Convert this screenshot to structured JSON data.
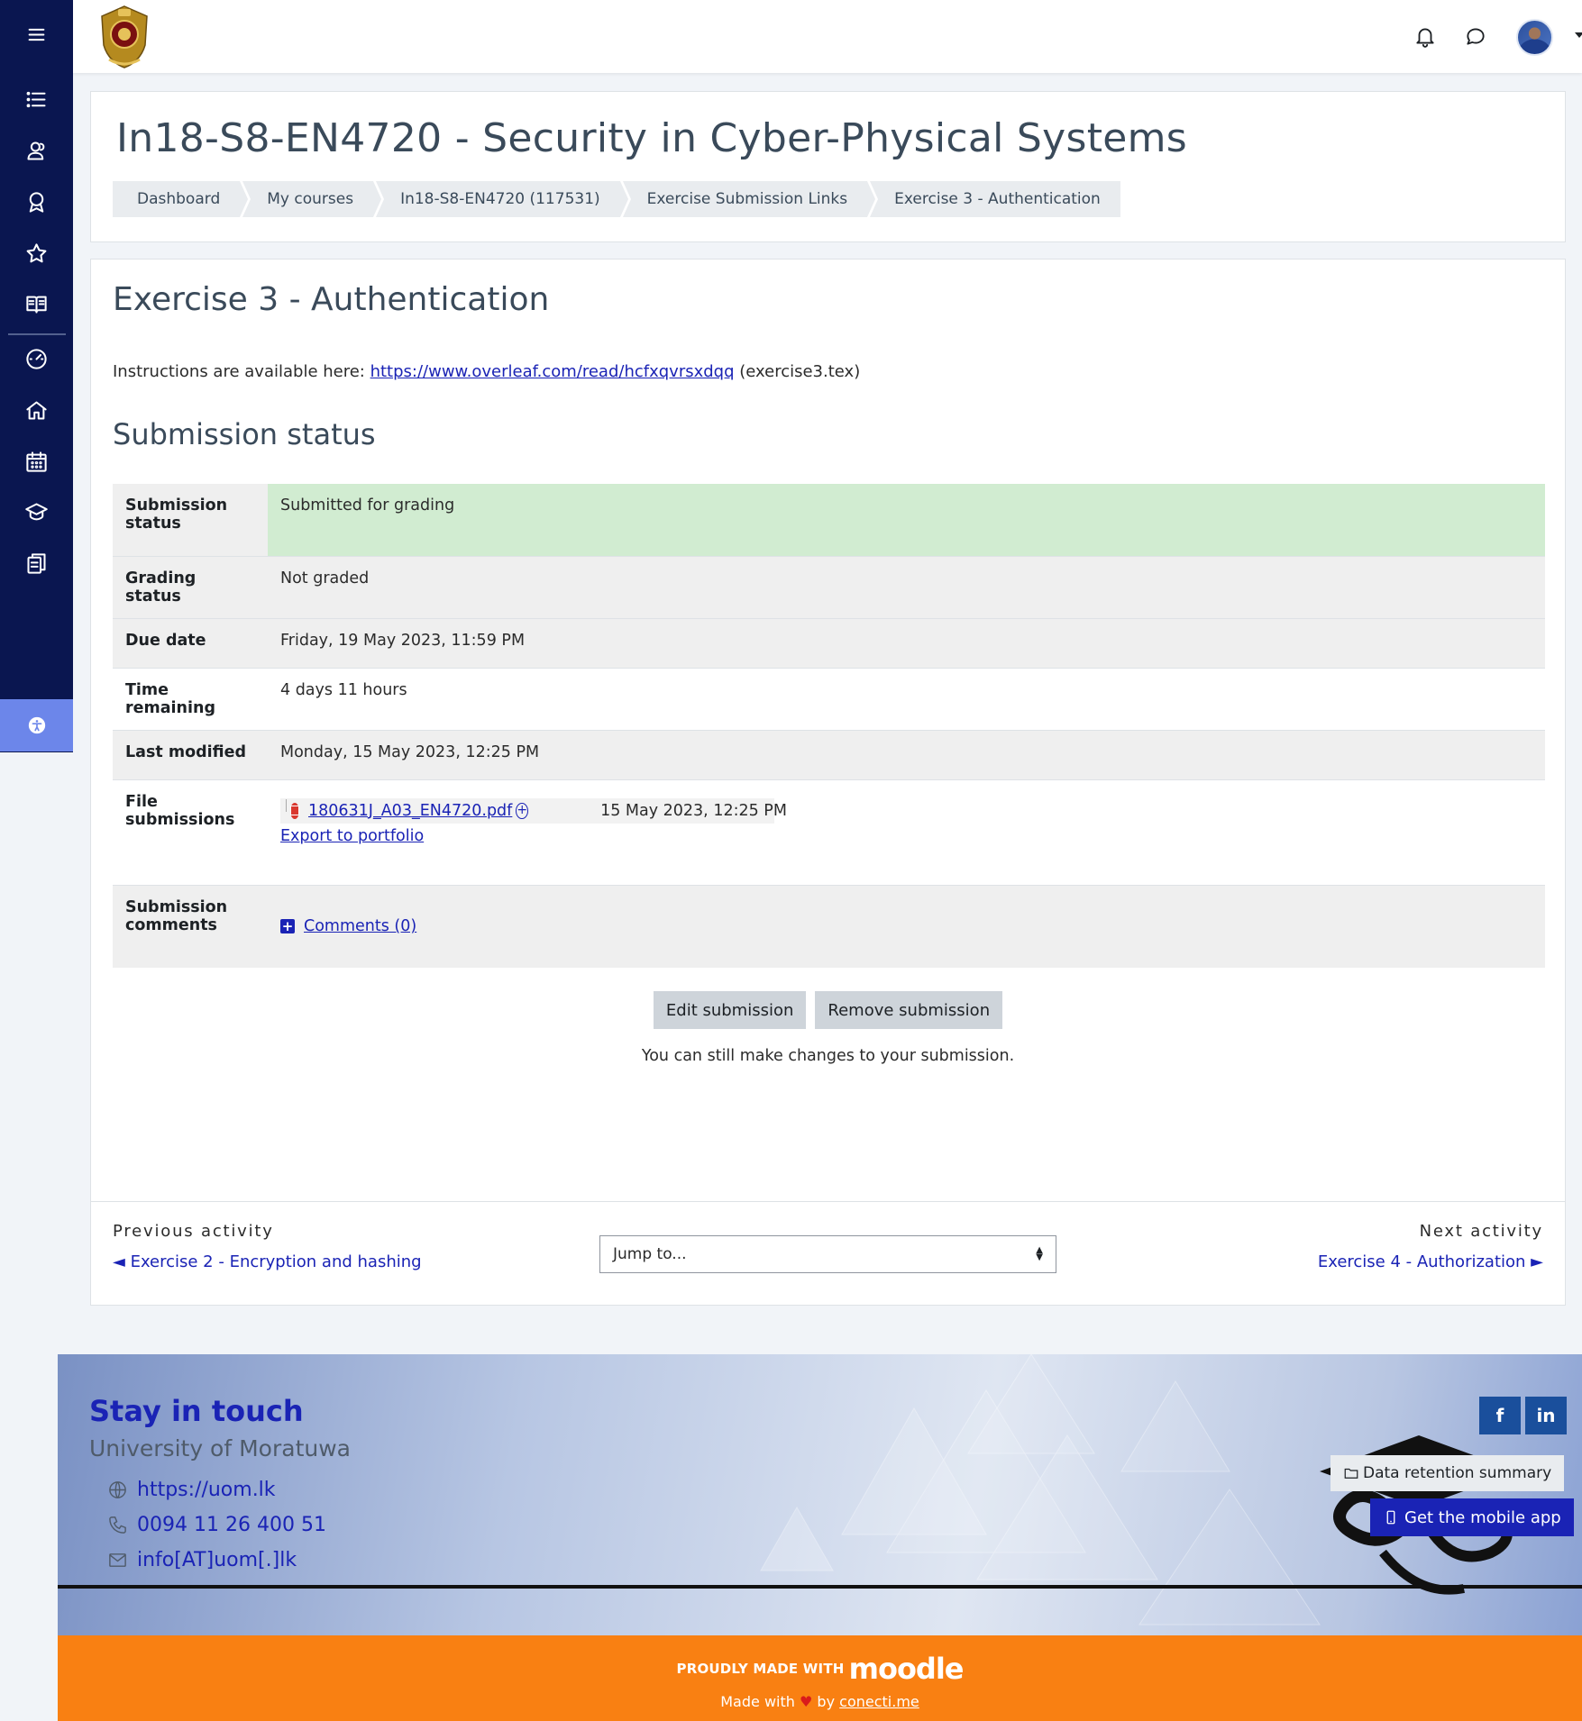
{
  "header": {
    "icons": [
      "bell-icon",
      "chat-icon"
    ]
  },
  "sidebar": {
    "items": [
      "list-icon",
      "participants-icon",
      "badge-icon",
      "star-icon",
      "book-icon",
      "dashboard-icon",
      "home-icon",
      "calendar-icon",
      "graduation-icon",
      "files-icon"
    ],
    "accessibility_icon": "accessibility-icon"
  },
  "page_header": {
    "course_title": "In18-S8-EN4720 - Security in Cyber-Physical Systems",
    "breadcrumb": [
      "Dashboard",
      "My courses",
      "In18-S8-EN4720 (117531)",
      "Exercise Submission Links",
      "Exercise 3 - Authentication"
    ]
  },
  "activity": {
    "title": "Exercise 3 - Authentication",
    "instructions_prefix": "Instructions are available here: ",
    "instructions_link": "https://www.overleaf.com/read/hcfxqvrsxdqq",
    "instructions_suffix": " (exercise3.tex)"
  },
  "submission_status": {
    "heading": "Submission status",
    "rows": {
      "submission_status": {
        "label": "Submission status",
        "value": "Submitted for grading"
      },
      "grading_status": {
        "label": "Grading status",
        "value": "Not graded"
      },
      "due_date": {
        "label": "Due date",
        "value": "Friday, 19 May 2023, 11:59 PM"
      },
      "time_remaining": {
        "label": "Time remaining",
        "value": "4 days 11 hours"
      },
      "last_modified": {
        "label": "Last modified",
        "value": "Monday, 15 May 2023, 12:25 PM"
      },
      "file_submissions": {
        "label": "File submissions",
        "file_name": "180631J_A03_EN4720.pdf",
        "file_date": "15 May 2023, 12:25 PM",
        "export_label": "Export to portfolio"
      },
      "submission_comments": {
        "label": "Submission comments",
        "link": "Comments (0)"
      }
    }
  },
  "actions": {
    "edit_label": "Edit submission",
    "remove_label": "Remove submission",
    "note": "You can still make changes to your submission."
  },
  "activity_nav": {
    "previous_label": "Previous activity",
    "previous_link": "◄ Exercise 2 - Encryption and hashing",
    "jump_placeholder": "Jump to...",
    "next_label": "Next activity",
    "next_link": "Exercise 4 - Authorization ►"
  },
  "footer": {
    "title": "Stay in touch",
    "university": "University of Moratuwa",
    "website": "https://uom.lk",
    "phone": "0094 11 26 400 51",
    "email": "info[AT]uom[.]lk",
    "social": {
      "facebook": "f",
      "linkedin": "in"
    },
    "data_retention": "Data retention summary",
    "mobile_app": "Get the mobile app",
    "proudly_made_with": "PROUDLY MADE WITH",
    "moodle": "moodle",
    "made_with": "Made with",
    "by": "by",
    "credit_link": "conecti.me"
  },
  "colors": {
    "sidebar_bg": "#0a1650",
    "accent_link": "#1a23b5",
    "submitted_bg": "#d1ecd1",
    "footer_orange": "#f98012"
  }
}
